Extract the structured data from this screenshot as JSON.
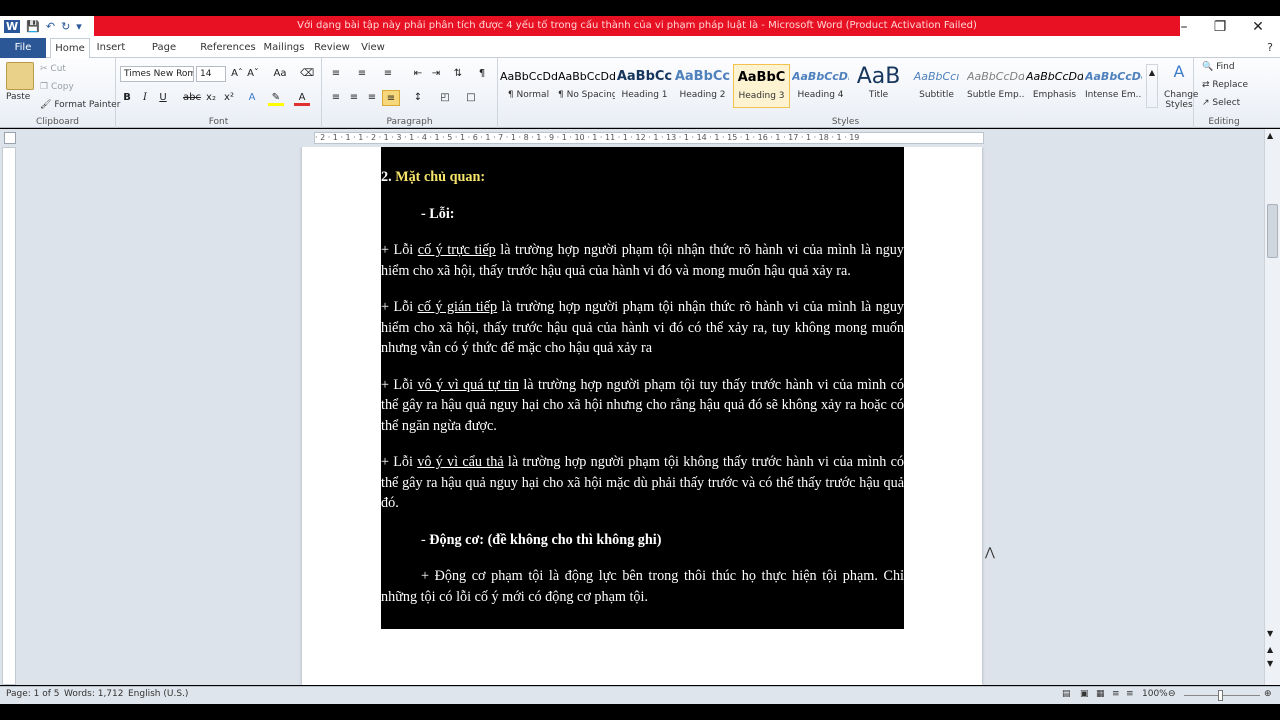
{
  "window": {
    "title": "Với dạng bài tập này phải phân tích được 4 yếu tố trong cấu thành của vi phạm pháp luật là - Microsoft Word (Product Activation Failed)"
  },
  "tabs": [
    "File",
    "Home",
    "Insert",
    "Page Layout",
    "References",
    "Mailings",
    "Review",
    "View"
  ],
  "clipboard": {
    "paste": "Paste",
    "cut": "Cut",
    "copy": "Copy",
    "format_painter": "Format Painter",
    "label": "Clipboard"
  },
  "font": {
    "name": "Times New Rom",
    "size": "14",
    "label": "Font"
  },
  "paragraph": {
    "label": "Paragraph"
  },
  "styles": {
    "items": [
      {
        "sample": "AaBbCcDd",
        "name": "¶ Normal"
      },
      {
        "sample": "AaBbCcDd",
        "name": "¶ No Spacing"
      },
      {
        "sample": "AaBbCc",
        "name": "Heading 1"
      },
      {
        "sample": "AaBbCc",
        "name": "Heading 2"
      },
      {
        "sample": "AaBbC",
        "name": "Heading 3"
      },
      {
        "sample": "AaBbCcDı",
        "name": "Heading 4"
      },
      {
        "sample": "AaB",
        "name": "Title"
      },
      {
        "sample": "AaBbCcı",
        "name": "Subtitle"
      },
      {
        "sample": "AaBbCcDd",
        "name": "Subtle Emp..."
      },
      {
        "sample": "AaBbCcDd",
        "name": "Emphasis"
      },
      {
        "sample": "AaBbCcDc",
        "name": "Intense Em..."
      }
    ],
    "change_styles": "Change Styles",
    "label": "Styles"
  },
  "editing": {
    "find": "Find",
    "replace": "Replace",
    "select": "Select",
    "label": "Editing"
  },
  "ruler_marks": "· 2 · 1 · 1 · 1 · 2 · 1 · 3 · 1 · 4 · 1 · 5 · 1 · 6 · 1 · 7 · 1 · 8 · 1 · 9 · 1 · 10 · 1 · 11 · 1 · 12 · 1 · 13 · 1 · 14 · 1 · 15 · 1 · 16 · 1 · 17 · 1 · 18 · 1 · 19",
  "document": {
    "heading_num": "2.",
    "heading": " Mặt chủ quan:",
    "loi_title": "- Lỗi:",
    "p1_pre": "+ Lỗi ",
    "p1_term": "cố ý trực tiếp",
    "p1_post": " là trường hợp người phạm tội nhận thức rõ hành vi của mình là nguy hiểm cho xã hội, thấy trước hậu quả của hành vi đó và mong muốn hậu quả xảy ra.",
    "p2_pre": "+ Lỗi ",
    "p2_term": "cố ý gián tiếp",
    "p2_post": " là trường hợp người phạm tội nhận thức rõ hành vi của mình là nguy hiểm cho xã hội, thấy trước hậu quả của hành vi đó có thể xảy ra, tuy không mong muốn nhưng vẫn có ý thức để mặc cho hậu quả xảy ra",
    "p3_pre": "+ Lỗi ",
    "p3_term": "vô ý vì quá tự tin",
    "p3_post": " là trường hợp người phạm tội tuy thấy trước hành vi của mình có thể gây ra hậu quả nguy hại cho xã hội nhưng cho rằng hậu quả đó sẽ không xảy ra hoặc có thể ngăn ngừa được.",
    "p4_pre": "+ Lỗi ",
    "p4_term": "vô ý vì cẩu thả",
    "p4_post": " là trường hợp người phạm tội không thấy trước hành vi của mình có thể gây ra hậu quả nguy hại cho xã hội mặc dù phải thấy trước và có thể thấy trước hậu quả đó.",
    "dongco_dash": "- ",
    "dongco_title": "Động cơ: (đề không cho thì không ghi)",
    "p5": "+ Động cơ phạm tội là động lực bên trong thôi thúc họ thực hiện tội phạm. Chỉ những tội có lỗi cố ý mới có động cơ phạm tội."
  },
  "status": {
    "page": "Page: 1 of 5",
    "words": "Words: 1,712",
    "language": "English (U.S.)",
    "zoom": "100%"
  }
}
